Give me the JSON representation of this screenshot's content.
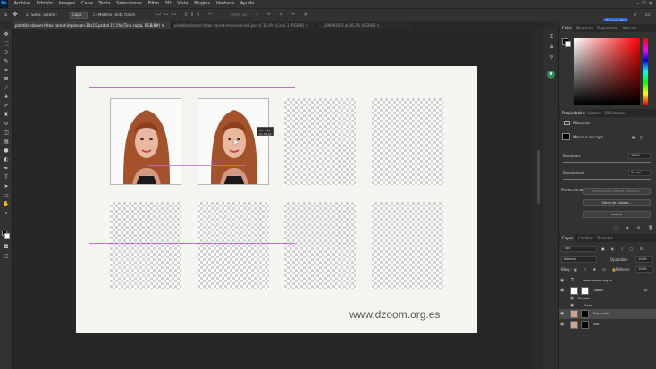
{
  "menubar": {
    "app": "Ps",
    "items": [
      "Archivo",
      "Edición",
      "Imagen",
      "Capa",
      "Texto",
      "Seleccionar",
      "Filtro",
      "3D",
      "Vista",
      "Plugins",
      "Ventana",
      "Ayuda"
    ]
  },
  "options": {
    "autoselect": "Selec. autom.:",
    "autoselect_value": "Capa",
    "transform": "Mostrar contr. transf.",
    "mode3d": "Modo 3D:",
    "share": "Compartir"
  },
  "tabs": [
    {
      "label": "plantilla-dzoom-fotos-carnet-impresion-10x15.psd al 15,1% (Tina copia, RGB/8#) ×",
      "active": true
    },
    {
      "label": "plantilla-dzoom-fotos-carnet-impresion-A4.psd al 15,4% (Capa 1, RGB/8) ×",
      "active": false
    },
    {
      "label": "..._1960619-2 al 16,7% (RGB/8) ×",
      "active": false
    }
  ],
  "document": {
    "watermark": "www.dzoom.org.es",
    "tooltip": [
      "An: 3 px",
      "Al: 30 px"
    ]
  },
  "color_panel": {
    "tabs": [
      "Color",
      "Muestras",
      "Degradados",
      "Motivos"
    ]
  },
  "properties": {
    "tabs": [
      "Propiedades",
      "Ajustes",
      "Bibliotecas"
    ],
    "masks_label": "Máscaras",
    "layer_mask": "Máscara de capa",
    "density_label": "Densidad:",
    "density_value": "100%",
    "feather_label": "Desvanecer:",
    "feather_value": "0,0 px",
    "refine_label": "Perfeccionar:",
    "select_mask_btn": "Seleccionar y aplicar máscara...",
    "color_range_btn": "Gama de colores...",
    "invert_btn": "Invertir"
  },
  "layers": {
    "tabs": [
      "Capas",
      "Canales",
      "Trazados"
    ],
    "filter": "Tipo",
    "blend": "Normal",
    "opacity_label": "Opacidad:",
    "opacity_value": "100%",
    "lock_label": "Bloq.:",
    "fill_label": "Relleno:",
    "fill_value": "100%",
    "items": [
      {
        "name": "www.dzoom.org.es",
        "type": "text"
      },
      {
        "name": "Capa 0",
        "type": "layer"
      },
      {
        "name": "Efectos",
        "type": "sub"
      },
      {
        "name": "Trazo",
        "type": "sub"
      },
      {
        "name": "Tina copia",
        "type": "layer",
        "selected": true
      },
      {
        "name": "Tina",
        "type": "layer"
      }
    ]
  },
  "colors": {
    "accent": "#2b6be3",
    "guide": "#c869d6"
  }
}
